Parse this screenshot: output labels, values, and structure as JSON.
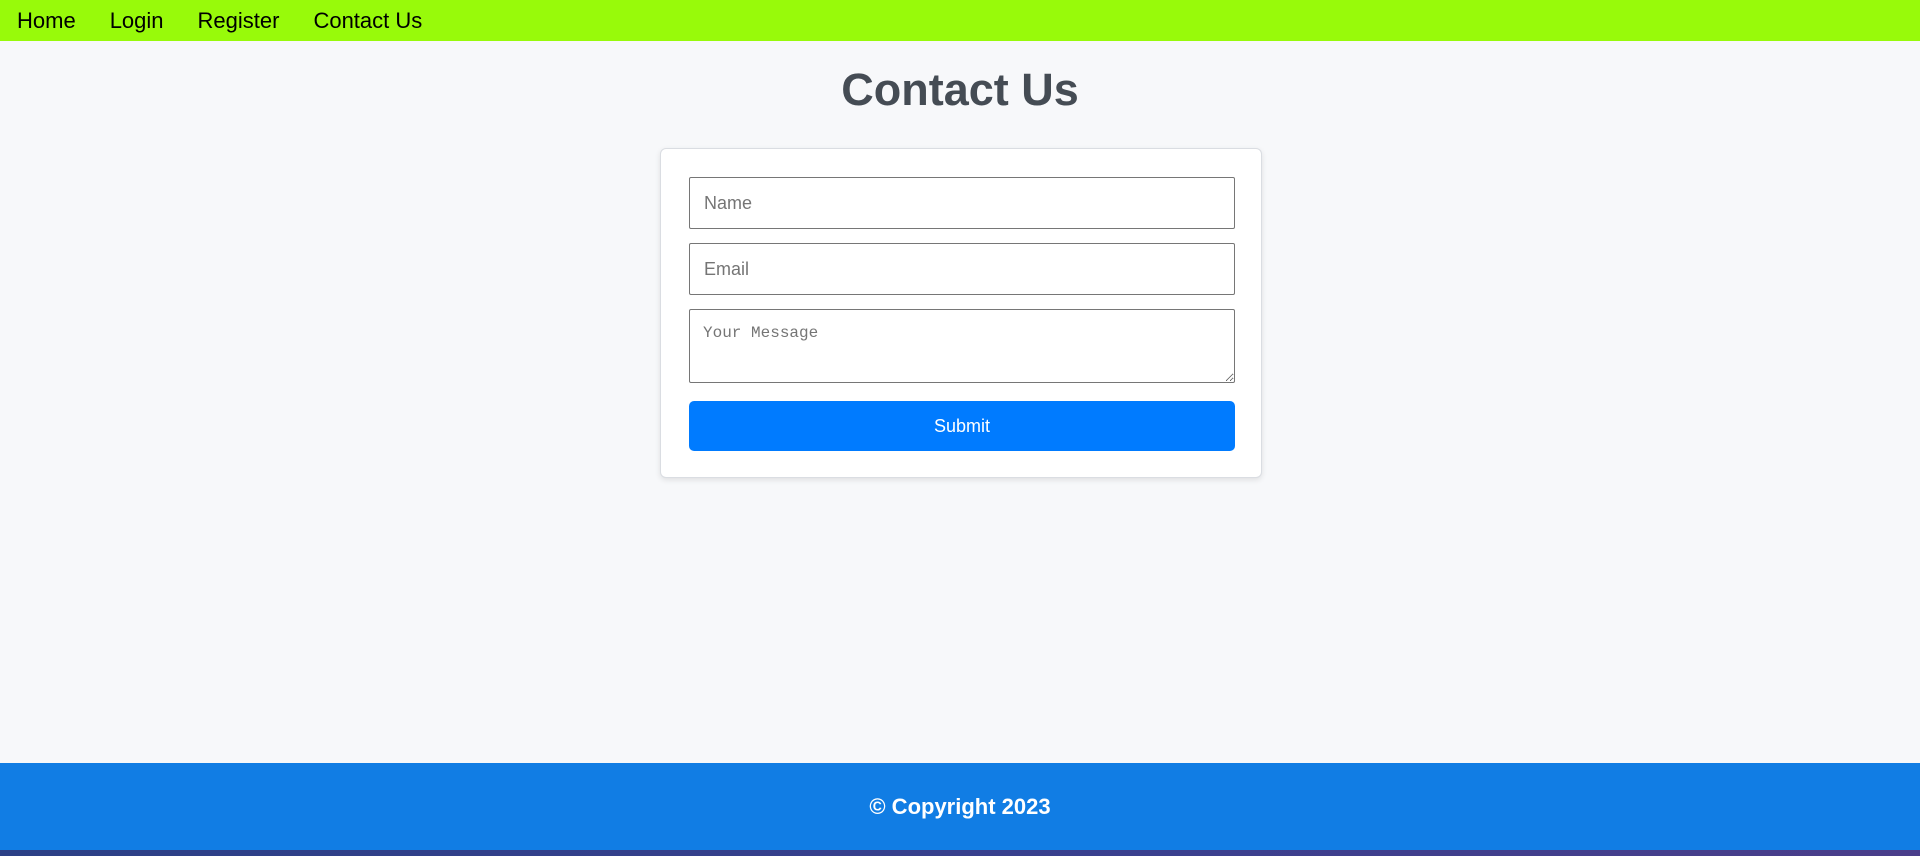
{
  "nav": {
    "items": [
      {
        "label": "Home"
      },
      {
        "label": "Login"
      },
      {
        "label": "Register"
      },
      {
        "label": "Contact Us"
      }
    ]
  },
  "main": {
    "title": "Contact Us",
    "form": {
      "name_placeholder": "Name",
      "email_placeholder": "Email",
      "message_placeholder": "Your Message",
      "submit_label": "Submit"
    }
  },
  "footer": {
    "text": "© Copyright 2023"
  },
  "colors": {
    "nav_bg": "#98fa0a",
    "submit_bg": "#007bff",
    "footer_bg": "#117de4",
    "title_text": "#454c54"
  }
}
